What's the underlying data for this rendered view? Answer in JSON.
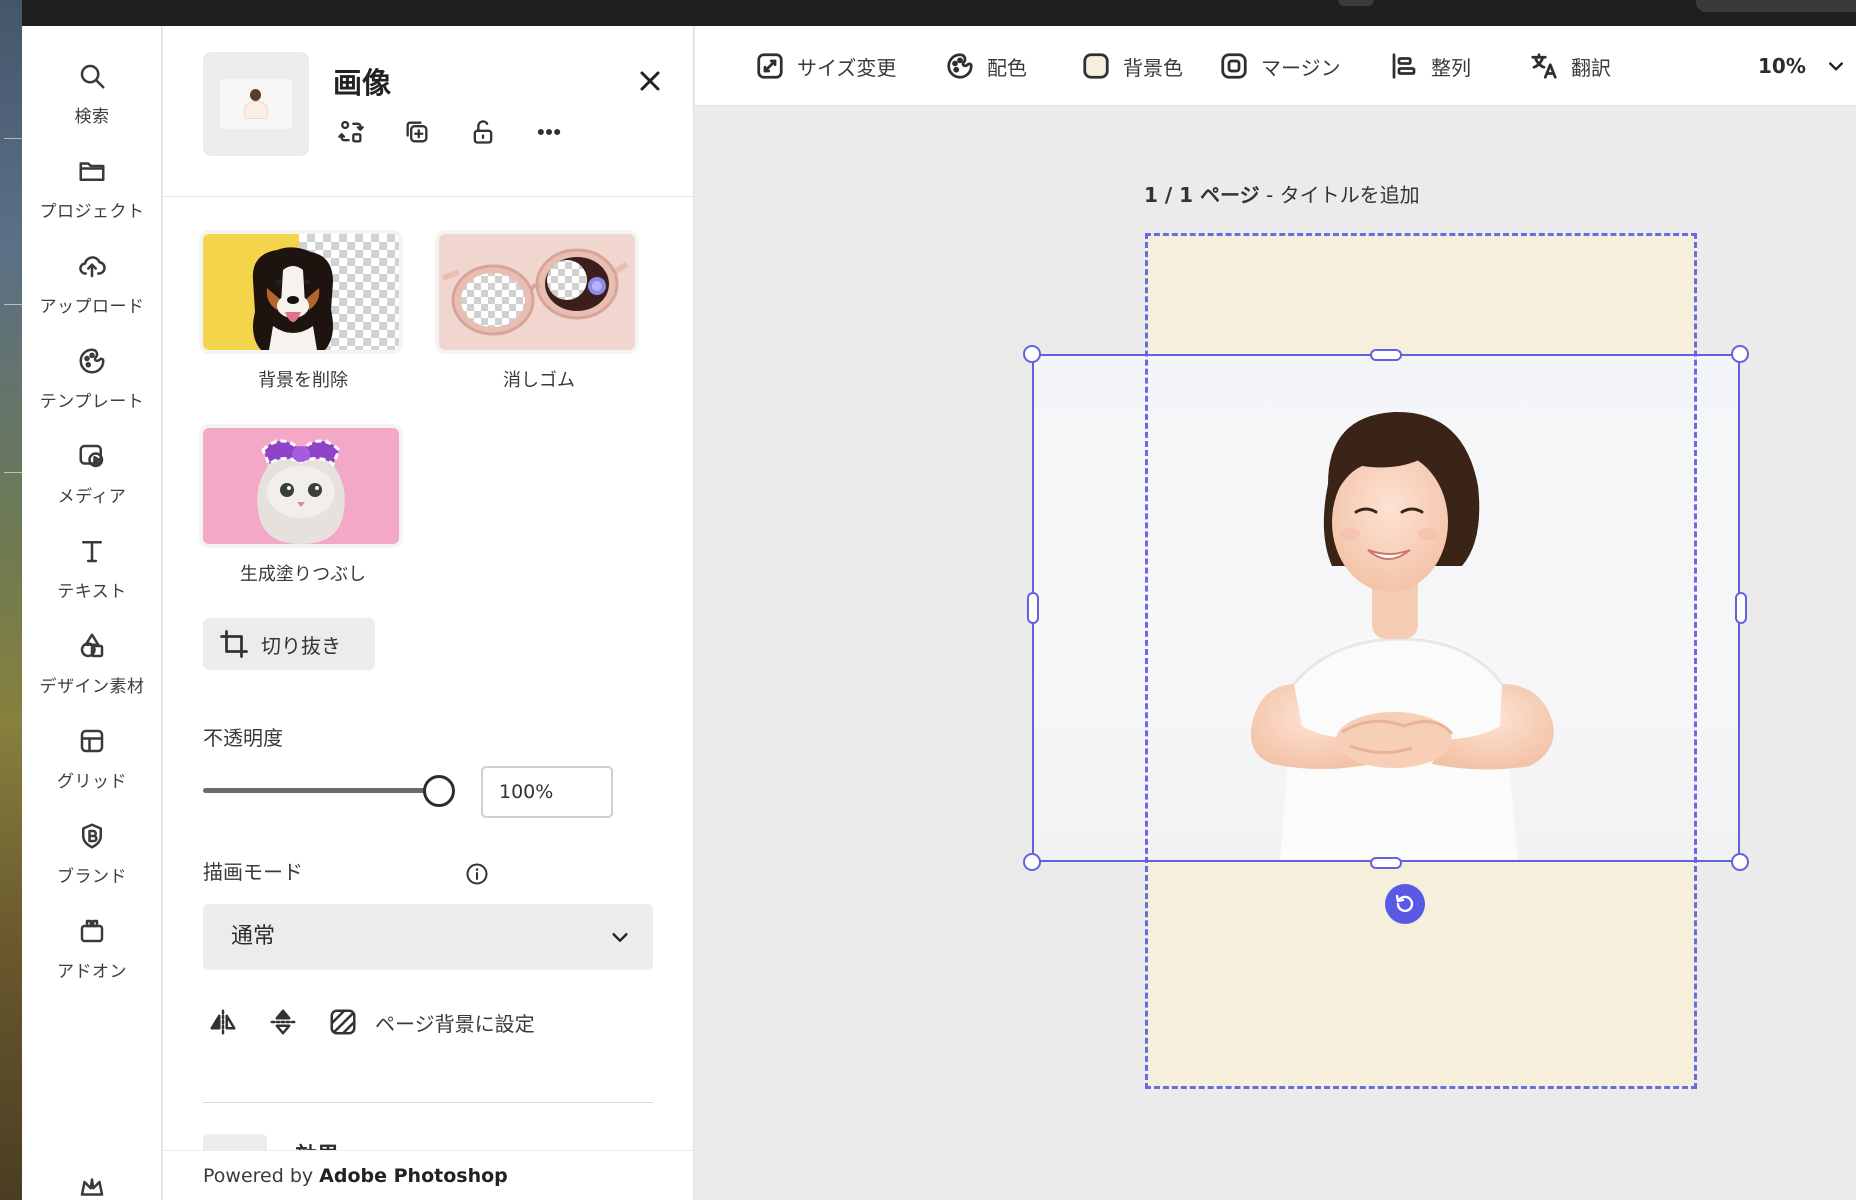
{
  "rail": [
    {
      "label": "検索",
      "icon": "search-icon"
    },
    {
      "label": "プロジェクト",
      "icon": "folder-icon"
    },
    {
      "label": "アップロード",
      "icon": "cloud-upload-icon"
    },
    {
      "label": "テンプレート",
      "icon": "template-icon"
    },
    {
      "label": "メディア",
      "icon": "media-icon"
    },
    {
      "label": "テキスト",
      "icon": "text-icon"
    },
    {
      "label": "デザイン素材",
      "icon": "shapes-icon"
    },
    {
      "label": "グリッド",
      "icon": "grid-icon"
    },
    {
      "label": "ブランド",
      "icon": "brand-icon"
    },
    {
      "label": "アドオン",
      "icon": "addon-icon"
    }
  ],
  "panel": {
    "title": "画像",
    "effects": [
      "背景を削除",
      "消しゴム",
      "生成塗りつぶし"
    ],
    "crop_label": "切り抜き",
    "opacity_label": "不透明度",
    "opacity_value": "100%",
    "opacity": 1.0,
    "blend_label": "描画モード",
    "blend_value": "通常",
    "set_bg_label": "ページ背景に設定",
    "effects_heading": "効果",
    "powered_prefix": "Powered by ",
    "powered_brand": "Adobe Photoshop"
  },
  "toolbar": {
    "items": [
      "サイズ変更",
      "配色",
      "背景色",
      "マージン",
      "整列",
      "翻訳"
    ],
    "zoom": "10%"
  },
  "canvas": {
    "page_num": "1 / 1 ページ",
    "page_title": " - タイトルを追加"
  },
  "colors": {
    "selection": "#6262e0",
    "page_background": "#f5efdc",
    "rotate_button": "#5959e6"
  }
}
